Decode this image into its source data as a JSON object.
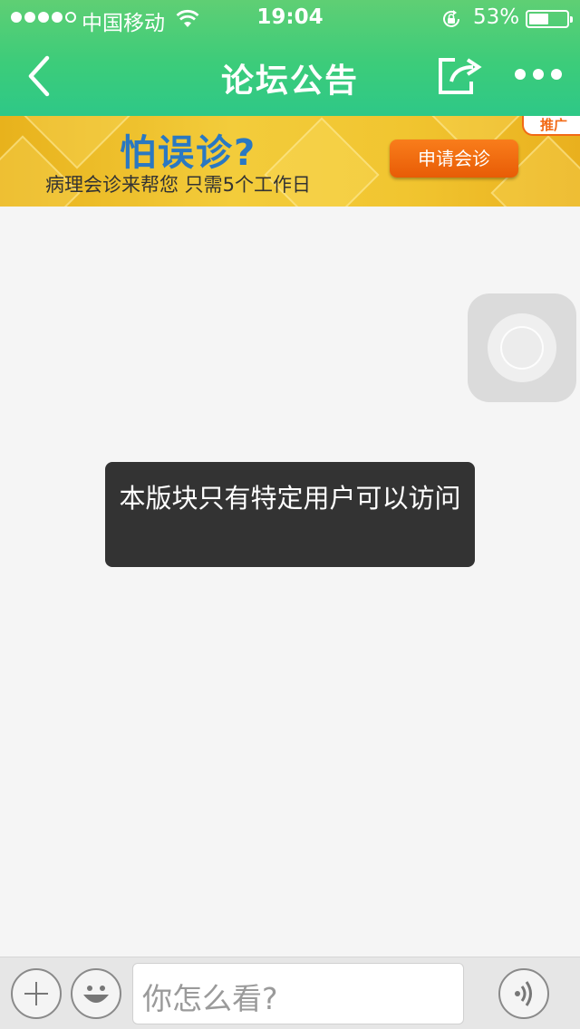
{
  "status_bar": {
    "carrier": "中国移动",
    "time": "19:04",
    "battery_percent": "53%",
    "battery_level": 0.53,
    "signal_bars_filled": 4,
    "signal_bars_total": 5
  },
  "nav": {
    "title": "论坛公告",
    "back_icon": "chevron-left-icon",
    "share_icon": "share-icon",
    "more_icon": "more-dots-icon"
  },
  "banner": {
    "headline": "怕误诊?",
    "subtitle": "病理会诊来帮您   只需5个工作日",
    "button_label": "申请会诊",
    "tag": "推广"
  },
  "toast": {
    "message": "本版块只有特定用户可以访问"
  },
  "bottom_bar": {
    "input_placeholder": "你怎么看?",
    "plus_icon": "plus-icon",
    "emoji_icon": "smiley-icon",
    "voice_icon": "voice-icon"
  },
  "colors": {
    "nav_green": "#3ccc7a",
    "banner_yellow": "#f3cc3b",
    "headline_blue": "#2a78c2",
    "button_orange": "#e85c06",
    "toast_bg": "#333333"
  }
}
